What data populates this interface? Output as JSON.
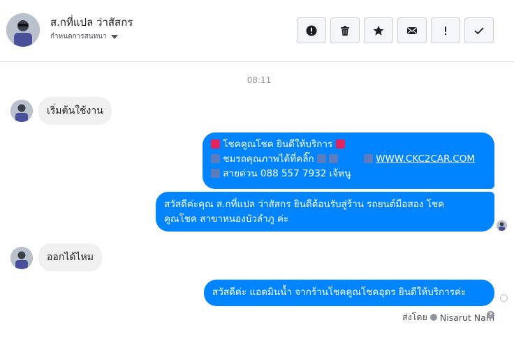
{
  "header": {
    "contact_name": "ส.กที่แปล ว่าสัสกร",
    "contact_sub": "กำหนดการสนทนา",
    "actions": [
      {
        "icon": "alert-circle-icon",
        "label": ""
      },
      {
        "icon": "trash-icon",
        "label": ""
      },
      {
        "icon": "star-icon",
        "label": ""
      },
      {
        "icon": "envelope-icon",
        "label": ""
      },
      {
        "icon": "exclamation-icon",
        "label": ""
      },
      {
        "icon": "check-icon",
        "label": ""
      }
    ]
  },
  "conversation": {
    "timestamp": "08:11",
    "messages": [
      {
        "direction": "in",
        "text": "เริ่มต้นใช้งาน"
      },
      {
        "direction": "out",
        "lines": [
          "โชคคูณโชค ยินดีให้บริการ",
          "ชมรถคุณภาพได้ที่คลิ๊ก",
          "WWW.CKC2CAR.COM",
          "สายด่วน 088 557 7932 เจ้หนู"
        ]
      },
      {
        "direction": "out",
        "lines": [
          "สวัสดีค่ะคุณ ส.กที่แปล ว่าสัสกร ยินดีต้อนรับสู่ร้าน รถยนต์มือสอง โชค",
          "คูณโชค สาขาหนองบัวลำภู ค่ะ"
        ]
      },
      {
        "direction": "in",
        "text": "ออกได้ไหม"
      },
      {
        "direction": "out",
        "text": "สวัสดีค่ะ แอดมินน้ำ จากร้านโชคคูณโชคอุดร ยินดีให้บริการค่ะ"
      }
    ],
    "sent_by_label": "ส่งโดย",
    "sent_by_name": "Nisarut Nam"
  },
  "colors": {
    "outgoing": "#0084ff",
    "incoming": "#f1f0f0",
    "emoji_red": "#e0245e",
    "emoji_blue": "#5b7cbd"
  }
}
